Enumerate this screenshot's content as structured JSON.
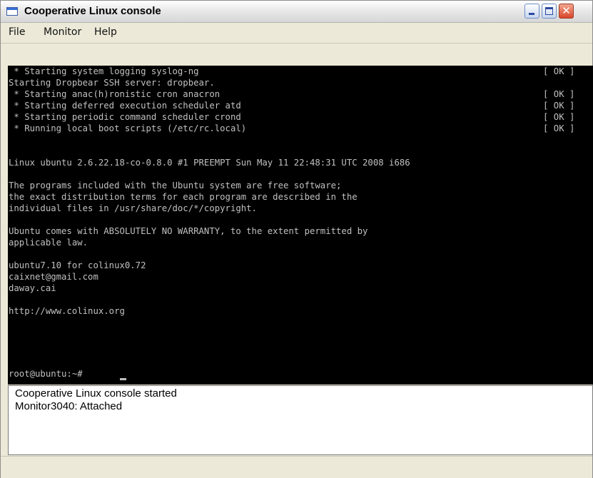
{
  "window": {
    "title": "Cooperative Linux console",
    "controls": {
      "minimize": "minimize",
      "maximize": "maximize",
      "close": "close"
    }
  },
  "menu": [
    "File",
    "Monitor",
    "Help"
  ],
  "console": {
    "lines": [
      " * Starting system logging syslog-ng",
      "Starting Dropbear SSH server: dropbear.",
      " * Starting anac(h)ronistic cron anacron",
      " * Starting deferred execution scheduler atd",
      " * Starting periodic command scheduler crond",
      " * Running local boot scripts (/etc/rc.local)",
      "",
      "Linux ubuntu 2.6.22.18-co-0.8.0 #1 PREEMPT Sun May 11 22:48:31 UTC 2008 i686",
      "",
      "The programs included with the Ubuntu system are free software;",
      "the exact distribution terms for each program are described in the",
      "individual files in /usr/share/doc/*/copyright.",
      "",
      "Ubuntu comes with ABSOLUTELY NO WARRANTY, to the extent permitted by",
      "applicable law.",
      "",
      "ubuntu7.10 for colinux0.72",
      "caixnet@gmail.com",
      "daway.cai",
      "",
      "http://www.colinux.org",
      "",
      "",
      "",
      "",
      "root@ubuntu:~# "
    ],
    "status_tags": [
      "[ OK ]",
      "[ OK ]",
      "[ OK ]",
      "[ OK ]",
      "[ OK ]"
    ]
  },
  "log": [
    "Cooperative Linux console started",
    "Monitor3040: Attached"
  ]
}
